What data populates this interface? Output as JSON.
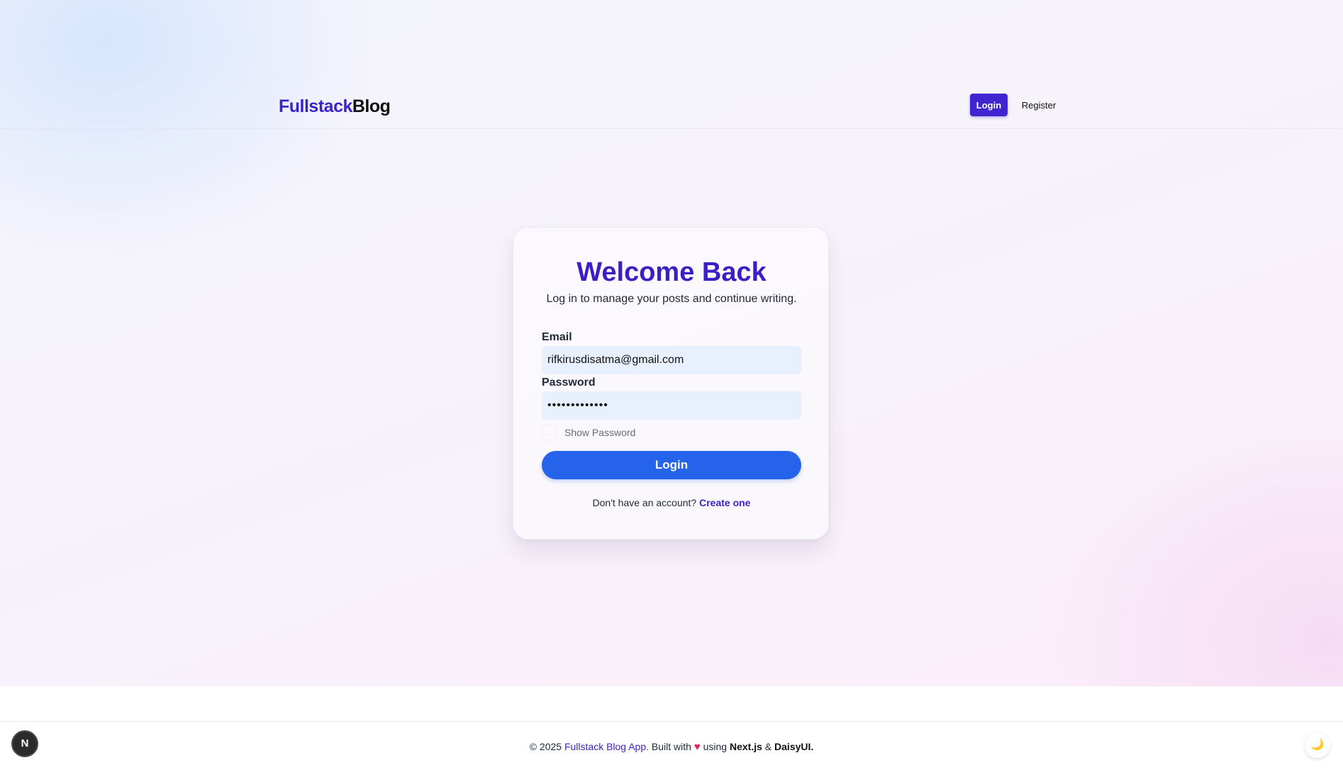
{
  "navbar": {
    "brand_part1": "Fullstack",
    "brand_part2": "Blog",
    "login_label": "Login",
    "register_label": "Register"
  },
  "login_card": {
    "title": "Welcome Back",
    "subtitle": "Log in to manage your posts and continue writing.",
    "email_label": "Email",
    "email_value": "rifkirusdisatma@gmail.com",
    "password_label": "Password",
    "password_value": "•••••••••••••",
    "show_password_label": "Show Password",
    "show_password_checked": false,
    "login_button": "Login",
    "signup_prompt": "Don't have an account?",
    "signup_link": "Create one"
  },
  "footer": {
    "copyright": "© 2025",
    "app_name": "Fullstack Blog App.",
    "built_with": "Built with",
    "heart_icon": "heart-icon",
    "using": "using",
    "framework": "Next.js",
    "amp": "&",
    "ui_lib": "DaisyUI."
  },
  "floating": {
    "next_badge": "N",
    "theme_toggle_icon": "🌙"
  },
  "colors": {
    "brand": "#3b23c8",
    "primary_button": "#2563eb",
    "nav_login_button": "#3f24cf",
    "input_bg": "#e8f0fe"
  }
}
